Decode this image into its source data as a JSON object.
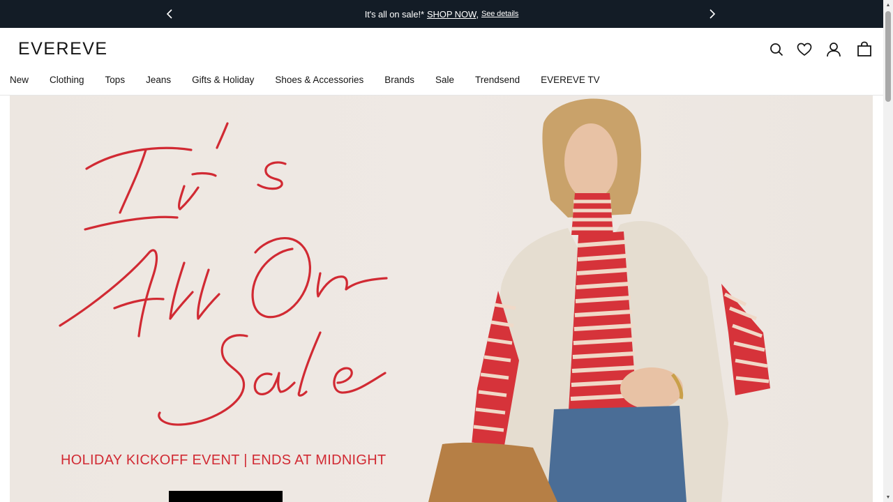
{
  "announcement": {
    "message": "It's all on sale!*",
    "shop_now": "SHOP NOW",
    "comma": ",",
    "see_details": "See details"
  },
  "header": {
    "logo": "EVEREVE",
    "nav": [
      "New",
      "Clothing",
      "Tops",
      "Jeans",
      "Gifts & Holiday",
      "Shoes & Accessories",
      "Brands",
      "Sale",
      "Trendsend",
      "EVEREVE TV"
    ],
    "icons": [
      "search-icon",
      "heart-icon",
      "account-icon",
      "bag-icon"
    ]
  },
  "hero": {
    "script_line1": "It's",
    "script_line2": "All On",
    "script_line3": "Sale",
    "event_text": "HOLIDAY KICKOFF EVENT | ENDS AT MIDNIGHT",
    "accent_color": "#d12a33"
  },
  "colors": {
    "announcement_bg": "#131c26",
    "hero_bg": "#ede7e1"
  }
}
